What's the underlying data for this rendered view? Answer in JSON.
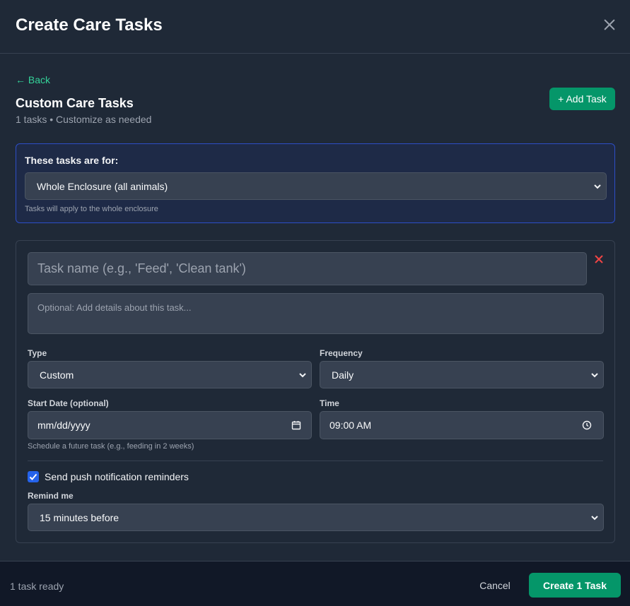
{
  "modal": {
    "title": "Create Care Tasks",
    "back_label": "← Back",
    "section_title": "Custom Care Tasks",
    "section_subtitle": "1 tasks • Customize as needed",
    "add_task_label": "+ Add Task"
  },
  "target": {
    "label": "These tasks are for:",
    "selected": "Whole Enclosure (all animals)",
    "help": "Tasks will apply to the whole enclosure"
  },
  "task": {
    "name_placeholder": "Task name (e.g., 'Feed', 'Clean tank')",
    "details_placeholder": "Optional: Add details about this task...",
    "type_label": "Type",
    "type_value": "Custom",
    "frequency_label": "Frequency",
    "frequency_value": "Daily",
    "start_date_label": "Start Date (optional)",
    "start_date_value": "mm/dd/yyyy",
    "start_date_help": "Schedule a future task (e.g., feeding in 2 weeks)",
    "time_label": "Time",
    "time_value": "09:00 AM",
    "notify_label": "Send push notification reminders",
    "notify_checked": true,
    "remind_label": "Remind me",
    "remind_value": "15 minutes before"
  },
  "footer": {
    "status": "1 task ready",
    "cancel_label": "Cancel",
    "create_label": "Create 1 Task"
  },
  "colors": {
    "accent": "#059669",
    "link": "#34d399",
    "danger": "#ef4444",
    "checkbox": "#2563eb"
  }
}
